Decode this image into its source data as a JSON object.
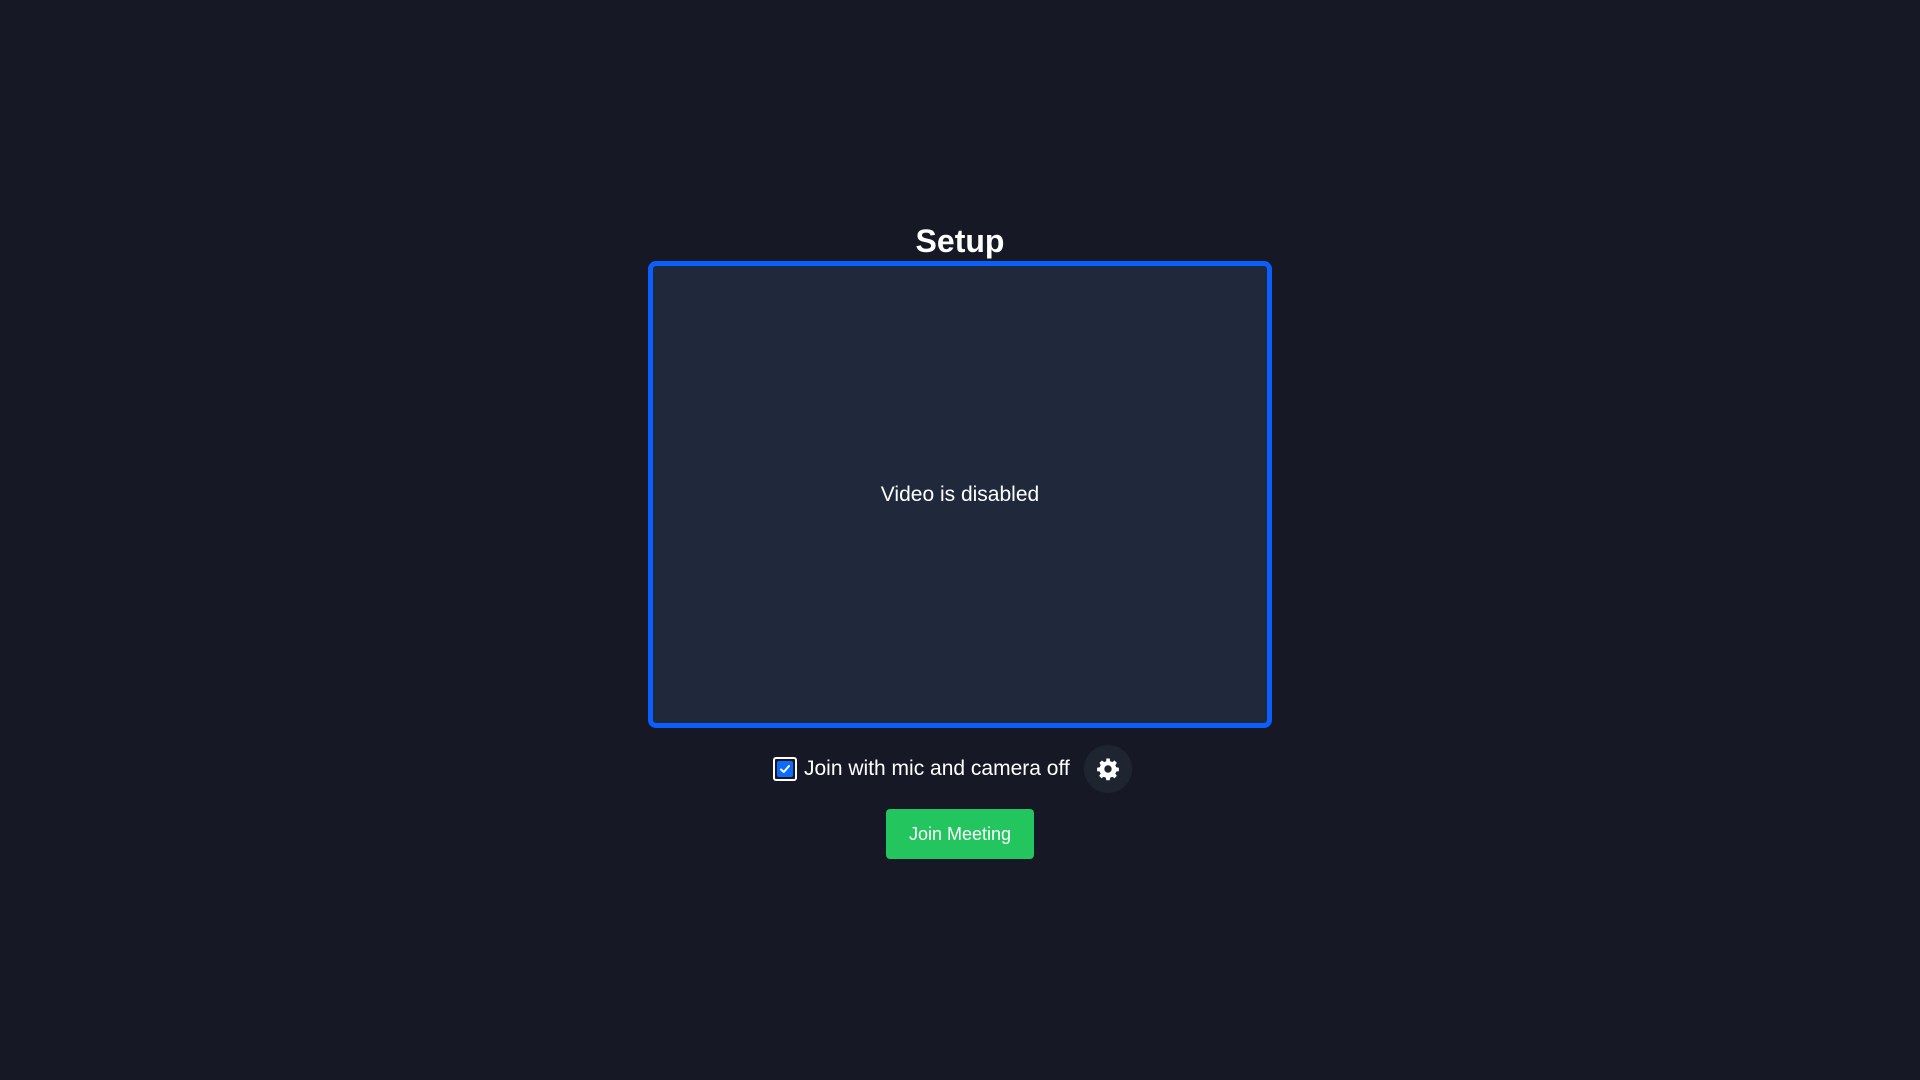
{
  "page": {
    "title": "Setup"
  },
  "video_preview": {
    "status_text": "Video is disabled",
    "border_color": "#0b5fff",
    "background_color": "#1f293b"
  },
  "options": {
    "mute_checkbox": {
      "label": "Join with mic and camera off",
      "checked": true
    },
    "settings_icon": "gear-icon"
  },
  "actions": {
    "join_label": "Join Meeting",
    "join_color": "#22c55e"
  },
  "theme": {
    "background": "#161825",
    "accent": "#0b6cff"
  }
}
